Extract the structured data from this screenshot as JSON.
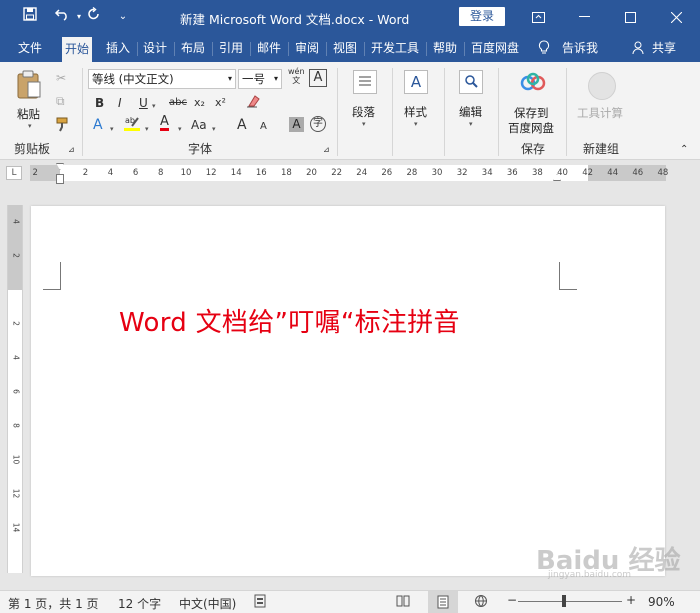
{
  "titlebar": {
    "title": "新建 Microsoft Word 文档.docx  -  Word",
    "login": "登录"
  },
  "tabs": [
    "文件",
    "开始",
    "插入",
    "设计",
    "布局",
    "引用",
    "邮件",
    "审阅",
    "视图",
    "开发工具",
    "帮助",
    "百度网盘"
  ],
  "tell_me": "告诉我",
  "share": "共享",
  "ribbon": {
    "clipboard": {
      "paste": "粘贴",
      "label": "剪贴板"
    },
    "font": {
      "name": "等线 (中文正文)",
      "size": "一号",
      "label": "字体",
      "row2": [
        "B",
        "I",
        "U",
        "abc",
        "x₂",
        "x²"
      ],
      "row3": [
        "A",
        "A",
        "Aa",
        "A",
        "A",
        "A"
      ]
    },
    "paragraph": {
      "label": "段落"
    },
    "styles": {
      "label": "样式"
    },
    "editing": {
      "label": "编辑"
    },
    "baidu": {
      "label_line1": "保存到",
      "label_line2": "百度网盘",
      "group": "保存"
    },
    "newgroup": {
      "label": "工具计算",
      "group": "新建组"
    }
  },
  "ruler": {
    "corner": "L",
    "ticks": [
      "2",
      "",
      "2",
      "4",
      "6",
      "8",
      "10",
      "12",
      "14",
      "16",
      "18",
      "20",
      "22",
      "24",
      "26",
      "28",
      "30",
      "32",
      "34",
      "36",
      "38",
      "40",
      "42",
      "44",
      "46",
      "48"
    ],
    "vticks": [
      "4",
      "2",
      "",
      "2",
      "4",
      "6",
      "8",
      "10",
      "12",
      "14"
    ]
  },
  "document": {
    "text": "Word 文档给”叮嘱“标注拼音"
  },
  "status": {
    "page": "第 1 页，共 1 页",
    "words": "12 个字",
    "lang": "中文(中国)",
    "zoom": "90%",
    "zoom_level": 0.9
  },
  "watermark": {
    "main": "Baidu 经验",
    "sub": "jingyan.baidu.com"
  },
  "colors": {
    "accent": "#2b579a",
    "text_red": "#e60012"
  }
}
